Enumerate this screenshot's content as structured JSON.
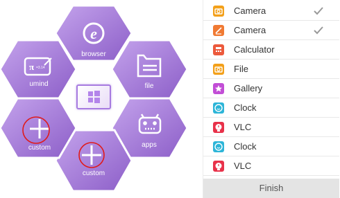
{
  "launcher": {
    "center_tile": "windows-logo-icon",
    "hexagons": [
      {
        "label": "browser",
        "icon": "browser-e-icon"
      },
      {
        "label": "file",
        "icon": "folder-icon"
      },
      {
        "label": "apps",
        "icon": "android-icon"
      },
      {
        "label": "custom",
        "icon": "plus-icon"
      },
      {
        "label": "custom",
        "icon": "plus-icon"
      },
      {
        "label": "umind",
        "icon": "pi-math-icon"
      }
    ]
  },
  "app_list": {
    "items": [
      {
        "label": "Camera",
        "icon": "camera-icon",
        "color": "#f3a01a",
        "checked": true
      },
      {
        "label": "Camera",
        "icon": "camera-pen-icon",
        "color": "#f07a33",
        "checked": true
      },
      {
        "label": "Calculator",
        "icon": "calculator-icon",
        "color": "#ec5a3c",
        "checked": false
      },
      {
        "label": "File",
        "icon": "folder-icon",
        "color": "#f3a01a",
        "checked": false
      },
      {
        "label": "Gallery",
        "icon": "star-icon",
        "color": "#c24ed6",
        "checked": false
      },
      {
        "label": "Clock",
        "icon": "clock-icon",
        "color": "#2db5d8",
        "checked": false
      },
      {
        "label": "VLC",
        "icon": "clock-red-icon",
        "color": "#e8324a",
        "checked": false
      },
      {
        "label": "Clock",
        "icon": "clock-icon",
        "color": "#2db5d8",
        "checked": false
      },
      {
        "label": "VLC",
        "icon": "clock-red-icon",
        "color": "#e8324a",
        "checked": false
      }
    ],
    "finish_label": "Finish"
  },
  "colors": {
    "hex_light": "#b995e6",
    "hex_dark": "#8b5fc6",
    "highlight_ring": "#e01a1a",
    "check": "#999999"
  }
}
